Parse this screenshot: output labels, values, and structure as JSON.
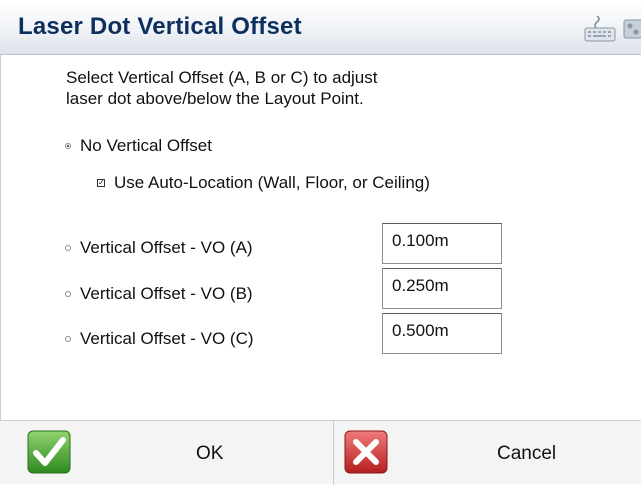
{
  "header": {
    "title": "Laser Dot Vertical Offset",
    "icons": [
      "keyboard-icon",
      "settings-icon"
    ]
  },
  "instructions": "Select Vertical Offset (A, B or C) to adjust\nlaser dot above/below the Layout Point.",
  "options": {
    "no_offset": {
      "label": "No Vertical Offset",
      "selected": true
    },
    "auto_location": {
      "label": "Use Auto-Location  (Wall, Floor, or Ceiling)",
      "checked": true
    },
    "vo_a": {
      "label": "Vertical Offset - VO (A)",
      "value": "0.100m",
      "selected": false
    },
    "vo_b": {
      "label": "Vertical Offset - VO (B)",
      "value": "0.250m",
      "selected": false
    },
    "vo_c": {
      "label": "Vertical Offset - VO (C)",
      "value": "0.500m",
      "selected": false
    }
  },
  "buttons": {
    "ok_label": "OK",
    "cancel_label": "Cancel"
  },
  "colors": {
    "title": "#0d2f5e",
    "ok_green": "#3f9e2a",
    "cancel_red": "#d32b2b"
  }
}
